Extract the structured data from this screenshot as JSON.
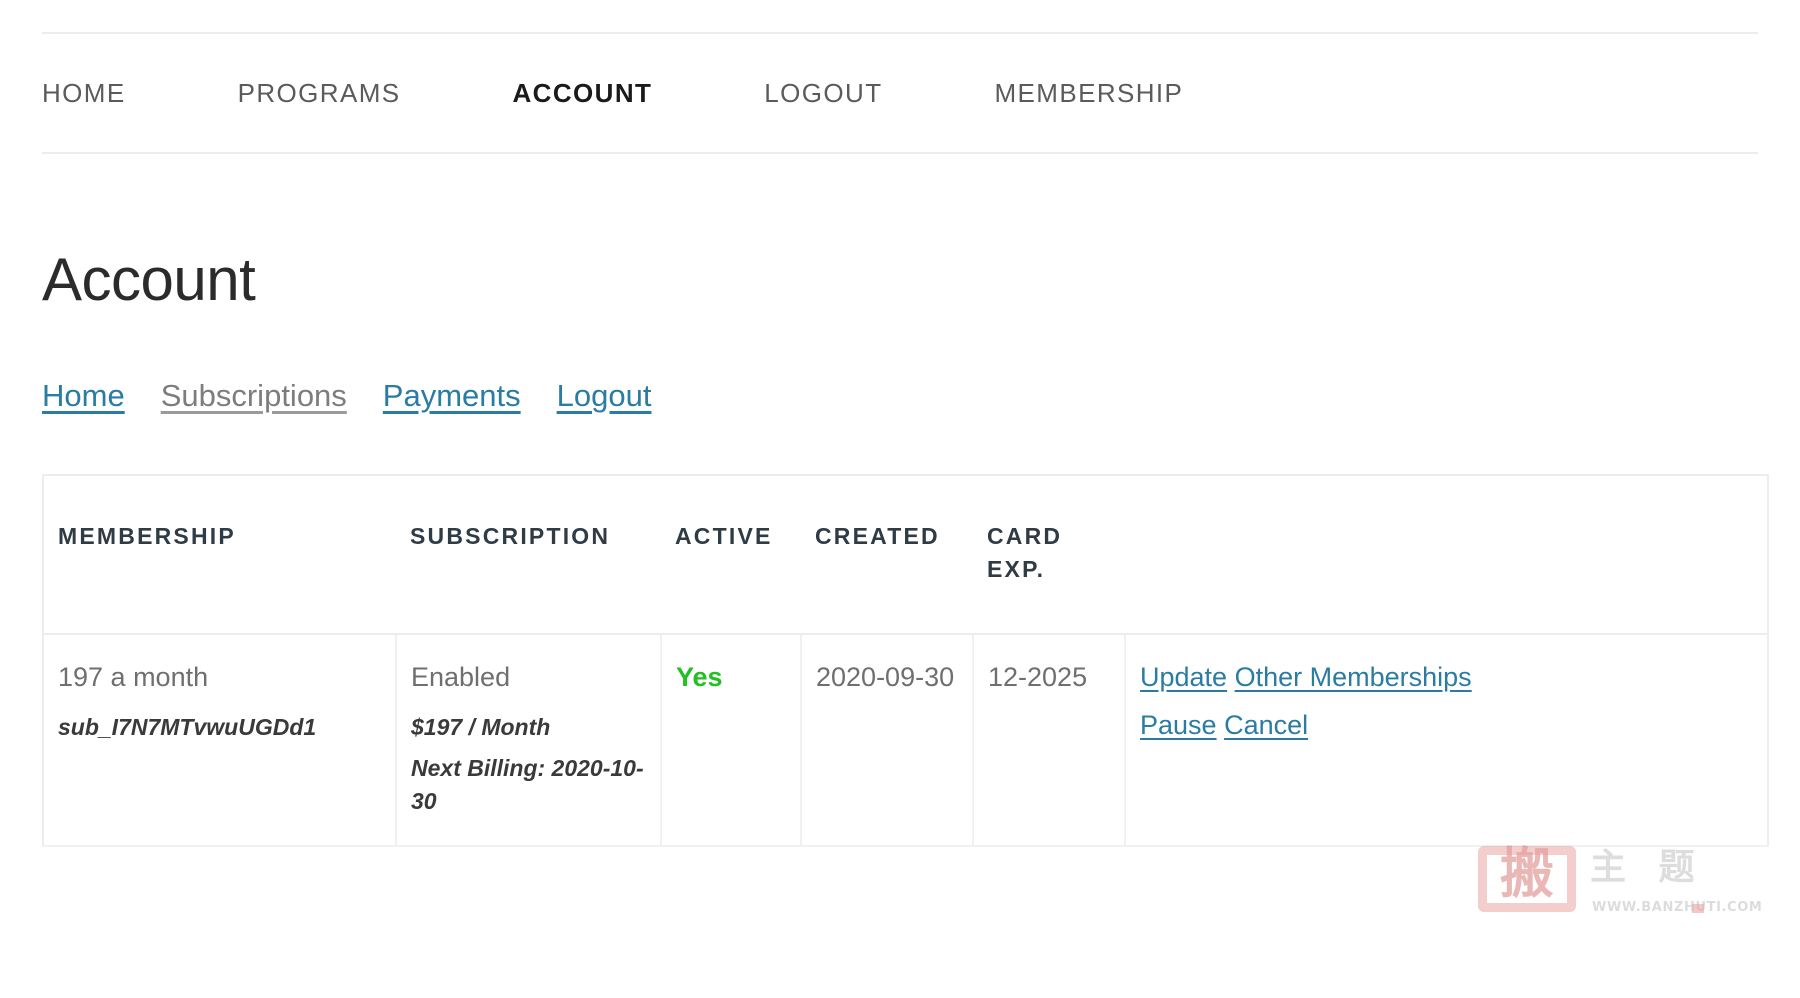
{
  "nav": {
    "items": [
      {
        "label": "Home",
        "active": false
      },
      {
        "label": "Programs",
        "active": false
      },
      {
        "label": "Account",
        "active": true
      },
      {
        "label": "Logout",
        "active": false
      },
      {
        "label": "Membership",
        "active": false
      }
    ]
  },
  "page": {
    "title": "Account"
  },
  "subnav": {
    "items": [
      {
        "label": "Home",
        "current": false
      },
      {
        "label": "Subscriptions",
        "current": true
      },
      {
        "label": "Payments",
        "current": false
      },
      {
        "label": "Logout",
        "current": false
      }
    ]
  },
  "table": {
    "headers": [
      "Membership",
      "Subscription",
      "Active",
      "Created",
      "Card Exp.",
      ""
    ],
    "rows": [
      {
        "membership_name": "197 a month",
        "membership_id": "sub_I7N7MTvwuUGDd1",
        "subscription_status": "Enabled",
        "subscription_price": "$197 / Month",
        "subscription_next_billing": "Next Billing: 2020-10-30",
        "active": "Yes",
        "created": "2020-09-30",
        "card_exp": "12-2025",
        "actions_line1": [
          "Update",
          "Other Memberships"
        ],
        "actions_line2": [
          "Pause",
          "Cancel"
        ]
      }
    ]
  },
  "watermark": {
    "seal_glyph": "搬",
    "text_cn": "主 题",
    "url": "WWW.BANZHUTI.COM"
  },
  "colors": {
    "link": "#2a7ca3",
    "active_yes": "#22c022",
    "body_text": "#6f6f6f",
    "header_text": "#2f3b45",
    "border": "#eceded",
    "seal_red": "#c83a3a"
  }
}
